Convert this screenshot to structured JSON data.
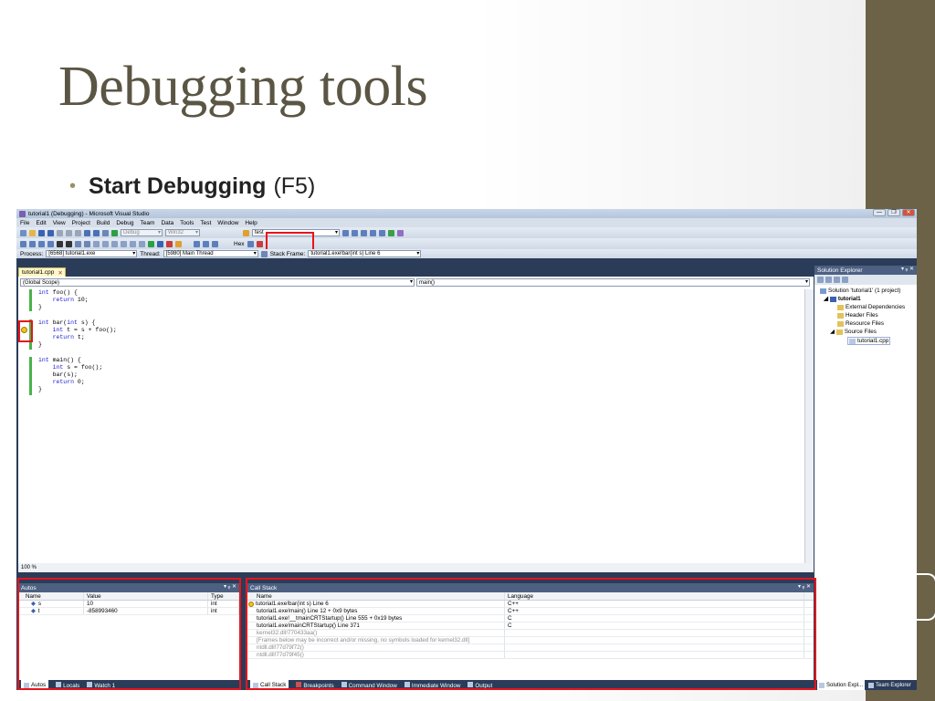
{
  "slide": {
    "title": "Debugging tools",
    "bullet_bold": "Start Debugging",
    "bullet_rest": "(F5)"
  },
  "window": {
    "title": "tutorial1 (Debugging) - Microsoft Visual Studio",
    "minimize": "—",
    "restore": "❐",
    "close": "✕"
  },
  "menu": [
    "File",
    "Edit",
    "View",
    "Project",
    "Build",
    "Debug",
    "Team",
    "Data",
    "Tools",
    "Test",
    "Window",
    "Help"
  ],
  "toolbar": {
    "config": "Debug",
    "platform": "Win32",
    "find": "test"
  },
  "debug_location": {
    "process_label": "Process:",
    "process_value": "[6568] tutorial1.exe",
    "thread_label": "Thread:",
    "thread_value": "[5980] Main Thread",
    "stack_label": "Stack Frame:",
    "stack_value": "tutorial1.exe!bar(int s)  Line 6"
  },
  "editor": {
    "tab": "tutorial1.cpp",
    "tab_close": "✕",
    "scope": "(Global Scope)",
    "member": "main()",
    "zoom": "100 %",
    "code": [
      "int foo() {",
      "    return 10;",
      "}",
      "",
      "int bar(int s) {",
      "    int t = s + foo();",
      "    return t;",
      "}",
      "",
      "int main() {",
      "    int s = foo();",
      "    bar(s);",
      "    return 0;",
      "}"
    ]
  },
  "solution_explorer": {
    "title": "Solution Explorer",
    "pin": "▾ ᵩ ✕",
    "items": [
      "Solution 'tutorial1' (1 project)",
      "tutorial1",
      "External Dependencies",
      "Header Files",
      "Resource Files",
      "Source Files",
      "tutorial1.cpp"
    ],
    "tab_sol": "Solution Expl...",
    "tab_team": "Team Explorer"
  },
  "autos": {
    "title": "Autos",
    "pin": "▾ ᵩ ✕",
    "headers": [
      "Name",
      "Value",
      "Type"
    ],
    "rows": [
      {
        "name": "s",
        "value": "10",
        "type": "int"
      },
      {
        "name": "t",
        "value": "-858993460",
        "type": "int"
      }
    ],
    "tabs": [
      "Autos",
      "Locals",
      "Watch 1"
    ]
  },
  "callstack": {
    "title": "Call Stack",
    "pin": "▾ ᵩ ✕",
    "headers": [
      "Name",
      "Language"
    ],
    "rows": [
      {
        "name": "tutorial1.exe!bar(int s)  Line 6",
        "lang": "C++"
      },
      {
        "name": "tutorial1.exe!main()  Line 12 + 0x9 bytes",
        "lang": "C++"
      },
      {
        "name": "tutorial1.exe!__tmainCRTStartup()  Line 555 + 0x19 bytes",
        "lang": "C"
      },
      {
        "name": "tutorial1.exe!mainCRTStartup()  Line 371",
        "lang": "C"
      },
      {
        "name": "kernel32.dll!770433aa()",
        "lang": ""
      },
      {
        "name": "[Frames below may be incorrect and/or missing, no symbols loaded for kernel32.dll]",
        "lang": ""
      },
      {
        "name": "ntdll.dll!77d79f72()",
        "lang": ""
      },
      {
        "name": "ntdll.dll!77d79f45()",
        "lang": ""
      }
    ],
    "tabs": [
      "Call Stack",
      "Breakpoints",
      "Command Window",
      "Immediate Window",
      "Output"
    ]
  }
}
